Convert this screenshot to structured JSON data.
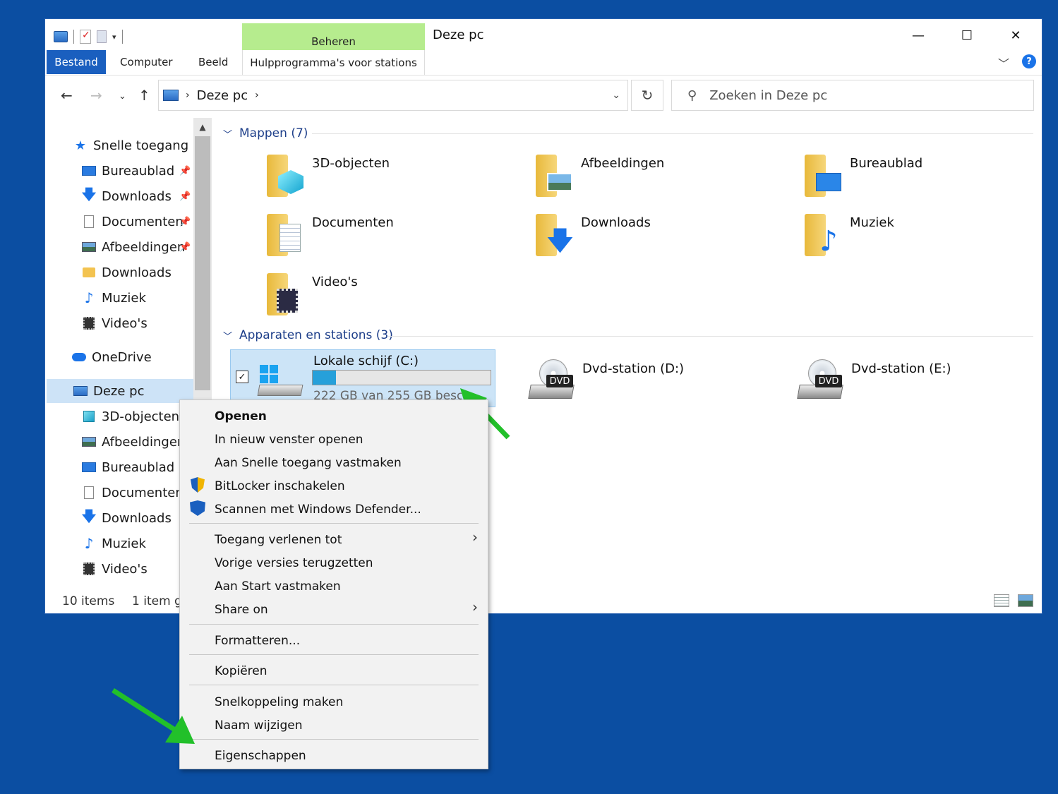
{
  "window": {
    "title": "Deze pc",
    "manage_tab": "Beheren",
    "manage_subtab": "Hulpprogramma's voor stations",
    "tabs": {
      "file": "Bestand",
      "computer": "Computer",
      "view": "Beeld"
    },
    "help": "?"
  },
  "nav": {
    "address": "Deze pc",
    "search_placeholder": "Zoeken in Deze pc"
  },
  "sidebar": {
    "quick_access": "Snelle toegang",
    "quick_items": [
      {
        "label": "Bureaublad",
        "pinned": true,
        "icon": "desktop-icon"
      },
      {
        "label": "Downloads",
        "pinned": true,
        "icon": "download-icon"
      },
      {
        "label": "Documenten",
        "pinned": true,
        "icon": "document-icon"
      },
      {
        "label": "Afbeeldingen",
        "pinned": true,
        "icon": "pictures-icon"
      },
      {
        "label": "Downloads",
        "pinned": false,
        "icon": "folder-icon"
      },
      {
        "label": "Muziek",
        "pinned": false,
        "icon": "music-icon"
      },
      {
        "label": "Video's",
        "pinned": false,
        "icon": "video-icon"
      }
    ],
    "onedrive": "OneDrive",
    "this_pc": "Deze pc",
    "pc_items": [
      {
        "label": "3D-objecten",
        "icon": "cube-icon"
      },
      {
        "label": "Afbeeldingen",
        "icon": "pictures-icon"
      },
      {
        "label": "Bureaublad",
        "icon": "desktop-icon"
      },
      {
        "label": "Documenten",
        "icon": "document-icon"
      },
      {
        "label": "Downloads",
        "icon": "download-icon"
      },
      {
        "label": "Muziek",
        "icon": "music-icon"
      },
      {
        "label": "Video's",
        "icon": "video-icon"
      }
    ]
  },
  "folders_group": {
    "title": "Mappen (7)",
    "items": [
      {
        "label": "3D-objecten",
        "icon": "cube-icon"
      },
      {
        "label": "Afbeeldingen",
        "icon": "pictures-icon"
      },
      {
        "label": "Bureaublad",
        "icon": "desktop-icon"
      },
      {
        "label": "Documenten",
        "icon": "document-icon"
      },
      {
        "label": "Downloads",
        "icon": "download-icon"
      },
      {
        "label": "Muziek",
        "icon": "music-icon"
      },
      {
        "label": "Video's",
        "icon": "video-icon"
      }
    ]
  },
  "drives_group": {
    "title": "Apparaten en stations (3)",
    "local_disk": {
      "label": "Lokale schijf (C:)",
      "free_text": "222 GB van 255 GB beschikbaar",
      "used_fraction": 0.13
    },
    "dvd_d": {
      "label": "Dvd-station (D:)",
      "tag": "DVD"
    },
    "dvd_e": {
      "label": "Dvd-station (E:)",
      "tag": "DVD"
    }
  },
  "status": {
    "items": "10 items",
    "selected": "1 item geselecteerd"
  },
  "context_menu": {
    "open": "Openen",
    "open_new_window": "In nieuw venster openen",
    "pin_quick": "Aan Snelle toegang vastmaken",
    "bitlocker": "BitLocker inschakelen",
    "defender": "Scannen met Windows Defender...",
    "give_access": "Toegang verlenen tot",
    "restore_versions": "Vorige versies terugzetten",
    "pin_start": "Aan Start vastmaken",
    "share_on": "Share on",
    "format": "Formatteren...",
    "copy": "Kopiëren",
    "shortcut": "Snelkoppeling maken",
    "rename": "Naam wijzigen",
    "properties": "Eigenschappen"
  },
  "colors": {
    "accent": "#1a5fbf",
    "desktop_bg": "#0b4ea2",
    "manage_tab": "#b6ec8e",
    "selection": "#cce4f7",
    "annotation_arrow": "#22c02a"
  }
}
